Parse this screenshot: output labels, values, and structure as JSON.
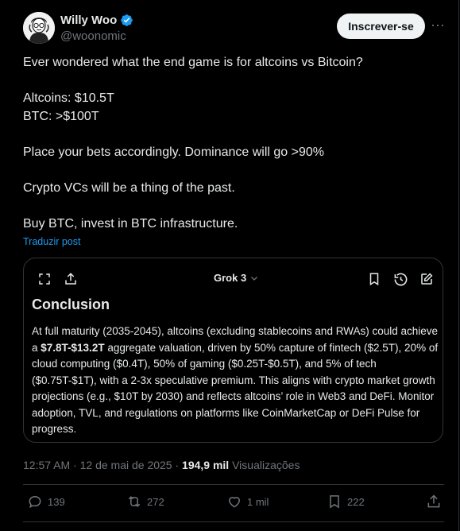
{
  "author": {
    "name": "Willy Woo",
    "handle": "@woonomic",
    "verified": true
  },
  "follow_label": "Inscrever-se",
  "tweet": {
    "line1": "Ever wondered what the end game is for altcoins vs Bitcoin?",
    "line2": "Altcoins: $10.5T",
    "line3": "BTC: >$100T",
    "line4": "Place your bets accordingly. Dominance will go >90%",
    "line5": "Crypto VCs will be a thing of the past.",
    "line6": "Buy BTC, invest in BTC infrastructure."
  },
  "translate_label": "Traduzir post",
  "grok_card": {
    "model_label": "Grok 3",
    "title": "Conclusion",
    "body_part1": "At full maturity (2035-2045), altcoins (excluding stablecoins and RWAs) could achieve a ",
    "body_bold": "$7.8T-$13.2T",
    "body_part2": " aggregate valuation, driven by 50% capture of fintech ($2.5T), 20% of cloud computing ($0.4T), 50% of gaming ($0.25T-$0.5T), and 5% of tech ($0.75T-$1T), with a 2-3x speculative premium. This aligns with crypto market growth projections (e.g., $10T by 2030) and reflects altcoins’ role in Web3 and DeFi. Monitor adoption, TVL, and regulations on platforms like CoinMarketCap or DeFi Pulse for progress."
  },
  "meta": {
    "time": "12:57 AM",
    "date": "12 de mai de 2025",
    "separator": "·",
    "views_count": "194,9 mil",
    "views_label": "Visualizações"
  },
  "actions": {
    "replies": "139",
    "reposts": "272",
    "likes": "1 mil",
    "bookmarks": "222"
  },
  "colors": {
    "background": "#000000",
    "text": "#e7e9ea",
    "secondary": "#71767b",
    "link": "#1d9bf0",
    "verified": "#1d9bf0",
    "border": "#2f3336"
  }
}
